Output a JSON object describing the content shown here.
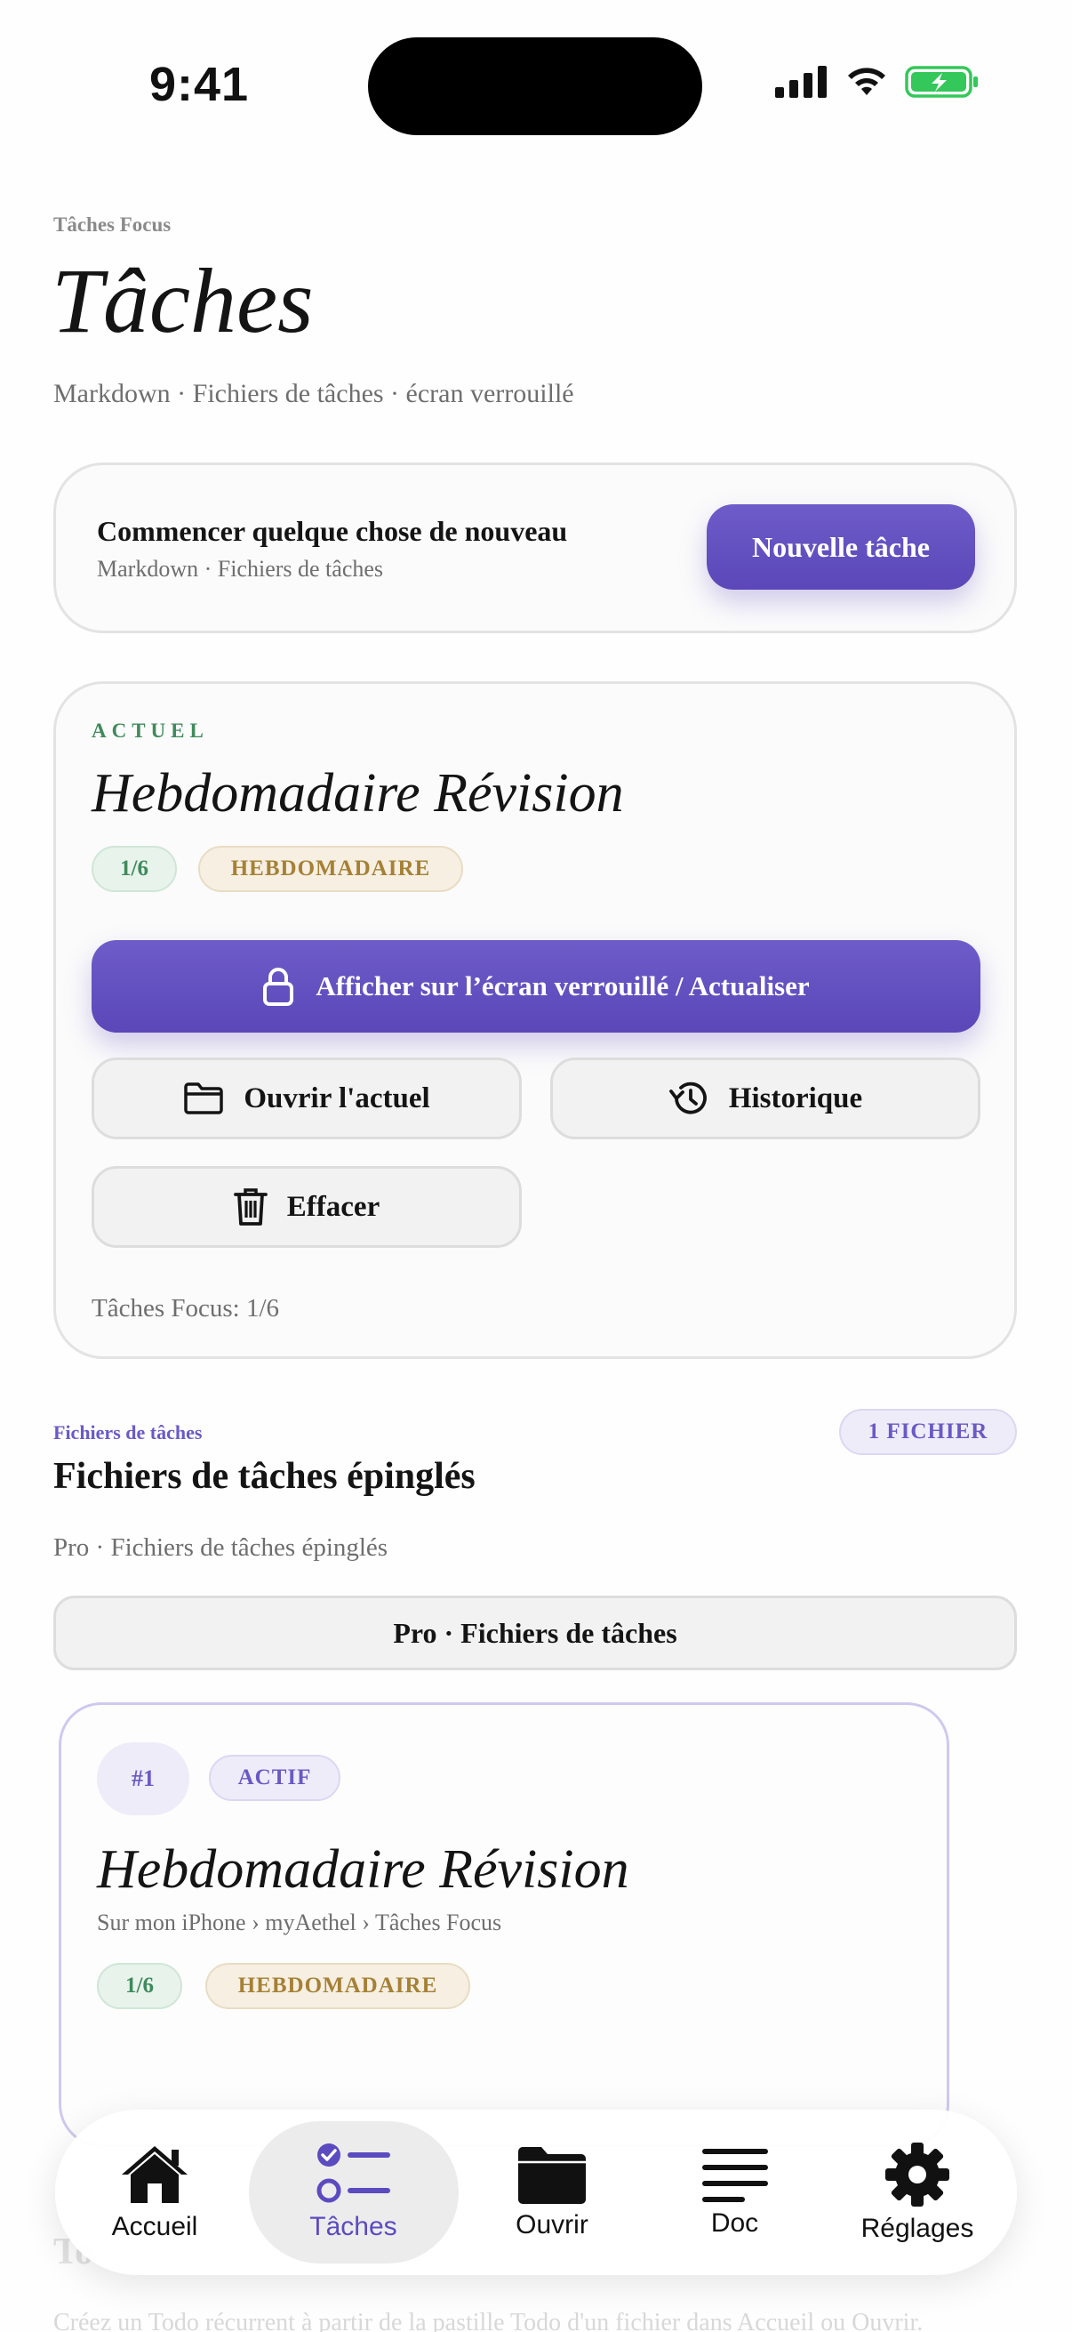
{
  "status_bar": {
    "time": "9:41"
  },
  "header": {
    "eyebrow": "Tâches Focus",
    "title": "Tâches",
    "subtitle": "Markdown · Fichiers de tâches · écran verrouillé"
  },
  "new_card": {
    "title": "Commencer quelque chose de nouveau",
    "subtitle": "Markdown · Fichiers de tâches",
    "button_label": "Nouvelle tâche"
  },
  "current_card": {
    "label": "ACTUEL",
    "title": "Hebdomadaire Révision",
    "progress_pill": "1/6",
    "frequency_pill": "HEBDOMADAIRE",
    "lock_button_label": "Afficher sur l’écran verrouillé / Actualiser",
    "open_button_label": "Ouvrir l'actuel",
    "history_button_label": "Historique",
    "clear_button_label": "Effacer",
    "footer": "Tâches Focus: 1/6"
  },
  "files_section": {
    "eyebrow": "Fichiers de tâches",
    "title": "Fichiers de tâches épinglés",
    "count_badge": "1 FICHIER",
    "subtitle": "Pro · Fichiers de tâches épinglés",
    "filter_label": "Pro · Fichiers de tâches"
  },
  "file_card": {
    "number": "#1",
    "state": "ACTIF",
    "title": "Hebdomadaire Révision",
    "path": "Sur mon iPhone › myAethel › Tâches Focus",
    "progress_pill": "1/6",
    "frequency_pill": "HEBDOMADAIRE"
  },
  "below_fold": {
    "title_partial": "To",
    "hint": "Créez un Todo récurrent à partir de la pastille Todo d'un fichier dans Accueil ou Ouvrir."
  },
  "tab_bar": {
    "tabs": [
      {
        "label": "Accueil",
        "icon": "house-icon"
      },
      {
        "label": "Tâches",
        "icon": "checklist-icon",
        "active": true
      },
      {
        "label": "Ouvrir",
        "icon": "folder-icon"
      },
      {
        "label": "Doc",
        "icon": "text-lines-icon"
      },
      {
        "label": "Réglages",
        "icon": "gear-icon"
      }
    ]
  },
  "colors": {
    "accent": "#5b47b8",
    "success": "#3f8a5c",
    "gold": "#a68035",
    "battery": "#34c759"
  }
}
